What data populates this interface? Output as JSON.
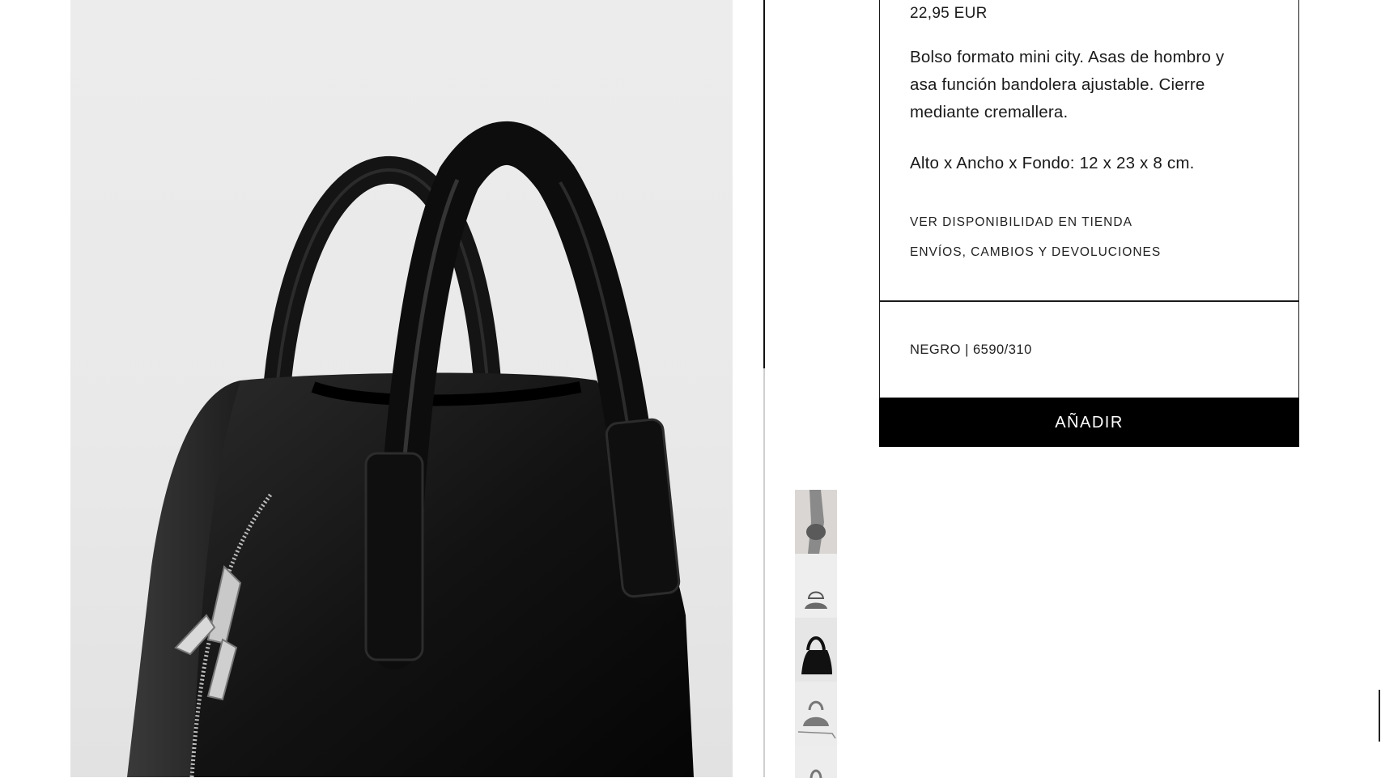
{
  "product": {
    "image_alt": "black mini city bag",
    "price": "22,95 EUR",
    "description": "Bolso formato mini city. Asas de hombro y asa función bandolera ajustable. Cierre mediante cremallera.",
    "dimensions": "Alto x Ancho x Fondo: 12 x 23 x 8 cm.",
    "links": [
      "VER DISPONIBILIDAD EN TIENDA",
      "ENVÍOS, CAMBIOS Y DEVOLUCIONES"
    ],
    "color_reference": "NEGRO | 6590/310",
    "add_button_label": "AÑADIR"
  },
  "thumbnails": [
    {
      "name": "model-wearing"
    },
    {
      "name": "bag-front-small"
    },
    {
      "name": "bag-angle",
      "active": true
    },
    {
      "name": "bag-with-strap"
    },
    {
      "name": "bag-partial"
    }
  ],
  "colors": {
    "button_bg": "#000000",
    "button_text": "#ffffff",
    "border": "#1a1a1a"
  },
  "icons": {
    "close": "close-icon"
  }
}
